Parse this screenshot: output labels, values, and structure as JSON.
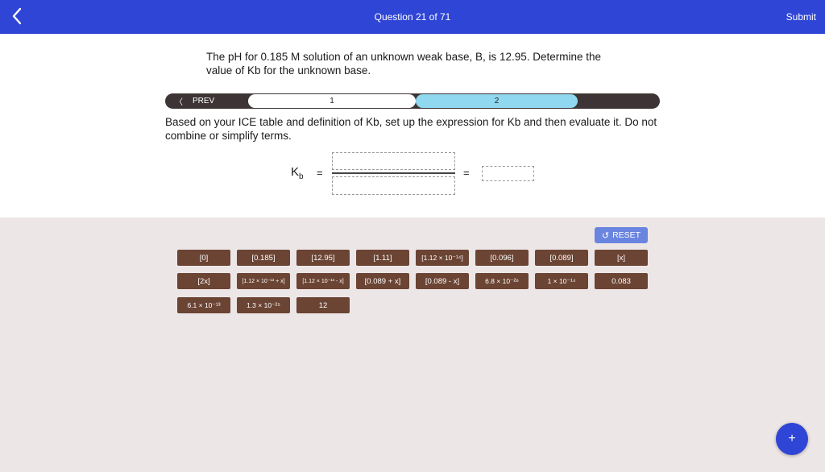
{
  "header": {
    "title": "Question 21 of 71",
    "submit_label": "Submit",
    "back_icon": "chevron-left-icon",
    "bg_color": "#2f45d6"
  },
  "question": {
    "text": "The pH for 0.185 M solution of an unknown weak base, B, is 12.95. Determine the value of Kb for the unknown base."
  },
  "steps": {
    "prev_label": "PREV",
    "items": [
      "1",
      "2"
    ],
    "active": "2"
  },
  "instructions": "Based on your ICE table and definition of Kb, set up the expression for Kb and then evaluate it. Do not combine or simplify terms.",
  "expression": {
    "kb_label": "K",
    "kb_sub": "b",
    "equals": "="
  },
  "bank": {
    "reset_label": "RESET",
    "tiles_row1": [
      "[0]",
      "[0.185]",
      "[12.95]",
      "[1.11]",
      "[1.12 × 10⁻¹⁴]",
      "[0.096]",
      "[0.089]",
      "[x]"
    ],
    "tiles_row2": [
      "[2x]",
      "[1.12 × 10⁻¹³ + x]",
      "[1.12 × 10⁻¹³ - x]",
      "[0.089 + x]",
      "[0.089 - x]",
      "6.8 × 10⁻²⁶",
      "1 × 10⁻¹⁴",
      "0.083"
    ],
    "tiles_row3": [
      "6.1 × 10⁻¹³",
      "1.3 × 10⁻²⁵",
      "12"
    ]
  },
  "fab_label": "+"
}
